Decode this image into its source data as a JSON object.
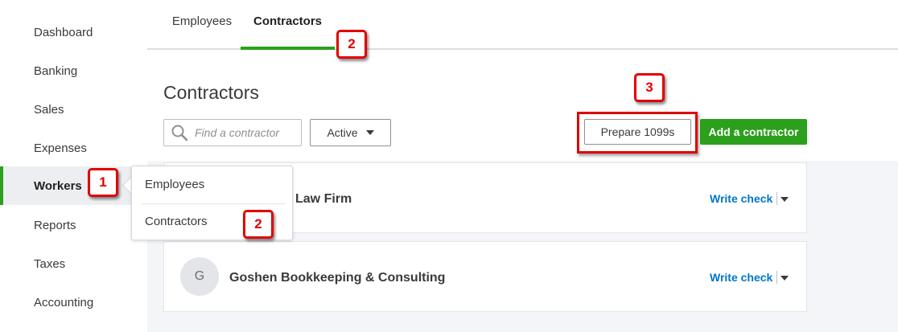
{
  "sidebar": {
    "items": [
      {
        "label": "Dashboard"
      },
      {
        "label": "Banking"
      },
      {
        "label": "Sales"
      },
      {
        "label": "Expenses"
      },
      {
        "label": "Workers"
      },
      {
        "label": "Reports"
      },
      {
        "label": "Taxes"
      },
      {
        "label": "Accounting"
      }
    ],
    "active": "Workers"
  },
  "tabs": [
    {
      "label": "Employees"
    },
    {
      "label": "Contractors"
    }
  ],
  "page": {
    "title": "Contractors",
    "search_placeholder": "Find a contractor",
    "filter_label": "Active",
    "prepare_label": "Prepare 1099s",
    "add_label": "Add a contractor"
  },
  "contractors": [
    {
      "name": "Law Firm",
      "action": "Write check"
    },
    {
      "initial": "G",
      "name": "Goshen Bookkeeping & Consulting",
      "action": "Write check"
    }
  ],
  "popover": {
    "items": [
      {
        "label": "Employees"
      },
      {
        "label": "Contractors"
      }
    ]
  },
  "annotations": [
    {
      "text": "1"
    },
    {
      "text": "2"
    },
    {
      "text": "2"
    },
    {
      "text": "3"
    }
  ],
  "colors": {
    "accent_green": "#2ca01c",
    "link_blue": "#0077c5",
    "annotation_red": "#e00000"
  }
}
